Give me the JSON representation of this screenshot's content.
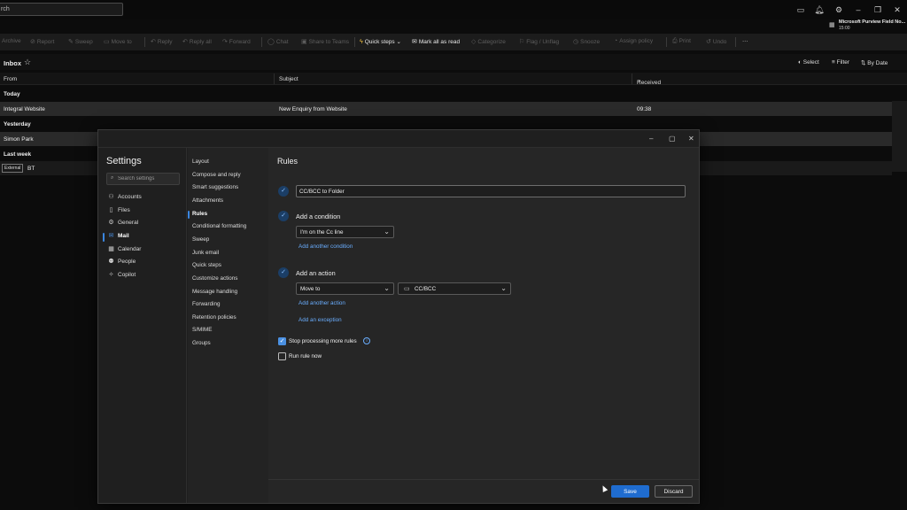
{
  "titlebar": {
    "search_text": "rch",
    "account_name": "Microsoft Purview Field No...",
    "account_time": "15:00"
  },
  "ribbon": {
    "items": [
      {
        "label": "Archive",
        "icon": "archive-icon"
      },
      {
        "label": "Report",
        "icon": "report-icon"
      },
      {
        "label": "Sweep",
        "icon": "sweep-icon"
      },
      {
        "label": "Move to",
        "icon": "folder-icon"
      },
      {
        "label": "Reply",
        "icon": "reply-icon"
      },
      {
        "label": "Reply all",
        "icon": "reply-all-icon"
      },
      {
        "label": "Forward",
        "icon": "forward-icon"
      },
      {
        "label": "Chat",
        "icon": "chat-icon"
      },
      {
        "label": "Share to Teams",
        "icon": "teams-icon"
      },
      {
        "label": "Quick steps",
        "icon": "lightning-icon"
      },
      {
        "label": "Mark all as read",
        "icon": "envelope-open-icon"
      },
      {
        "label": "Categorize",
        "icon": "tag-icon"
      },
      {
        "label": "Flag / Unflag",
        "icon": "flag-icon"
      },
      {
        "label": "Snooze",
        "icon": "clock-icon"
      },
      {
        "label": "Assign policy",
        "icon": "policy-icon"
      },
      {
        "label": "Print",
        "icon": "print-icon"
      },
      {
        "label": "Undo",
        "icon": "undo-icon"
      }
    ]
  },
  "inbox": {
    "title": "Inbox",
    "select_label": "Select",
    "filter_label": "Filter",
    "sort_label": "By Date",
    "columns": {
      "from": "From",
      "subject": "Subject",
      "received": "Received"
    },
    "groups": {
      "today": "Today",
      "yesterday": "Yesterday",
      "last_week": "Last week"
    },
    "rows": [
      {
        "from": "Integral Website",
        "subject": "New Enquiry from Website",
        "received": "09:38"
      },
      {
        "from": "Simon Park"
      }
    ],
    "external_badge": "External",
    "last_week_from": "BT"
  },
  "settings": {
    "title": "Settings",
    "search_placeholder": "Search settings",
    "categories": [
      {
        "label": "Accounts",
        "icon": "person-icon"
      },
      {
        "label": "Files",
        "icon": "file-icon"
      },
      {
        "label": "General",
        "icon": "gear-icon"
      },
      {
        "label": "Mail",
        "icon": "mail-icon"
      },
      {
        "label": "Calendar",
        "icon": "calendar-icon"
      },
      {
        "label": "People",
        "icon": "people-icon"
      },
      {
        "label": "Copilot",
        "icon": "copilot-icon"
      }
    ],
    "mail_sections": [
      "Layout",
      "Compose and reply",
      "Smart suggestions",
      "Attachments",
      "Rules",
      "Conditional formatting",
      "Sweep",
      "Junk email",
      "Quick steps",
      "Customize actions",
      "Message handling",
      "Forwarding",
      "Retention policies",
      "S/MIME",
      "Groups"
    ]
  },
  "rules": {
    "title": "Rules",
    "rule_name": "CC/BCC to Folder",
    "condition_label": "Add a condition",
    "condition_value": "I'm on the Cc line",
    "add_condition": "Add another condition",
    "action_label": "Add an action",
    "action_value": "Move to",
    "folder_value": "CC/BCC",
    "add_action": "Add another action",
    "add_exception": "Add an exception",
    "stop_processing": "Stop processing more rules",
    "run_now": "Run rule now",
    "save": "Save",
    "discard": "Discard"
  }
}
